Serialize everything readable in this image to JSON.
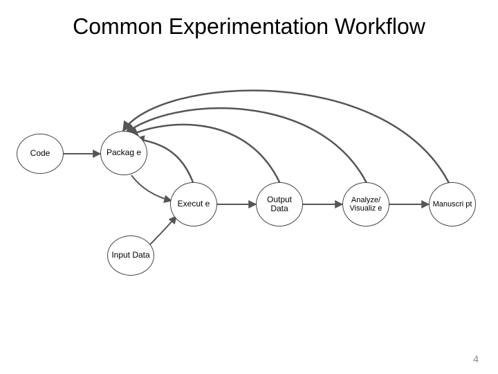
{
  "title": "Common Experimentation Workflow",
  "nodes": {
    "code": "Code",
    "package": "Packag e",
    "execute": "Execut e",
    "output": "Output Data",
    "analyze": "Analyze/ Visualiz e",
    "manuscript": "Manuscri pt",
    "input": "Input Data"
  },
  "page_number": "4"
}
